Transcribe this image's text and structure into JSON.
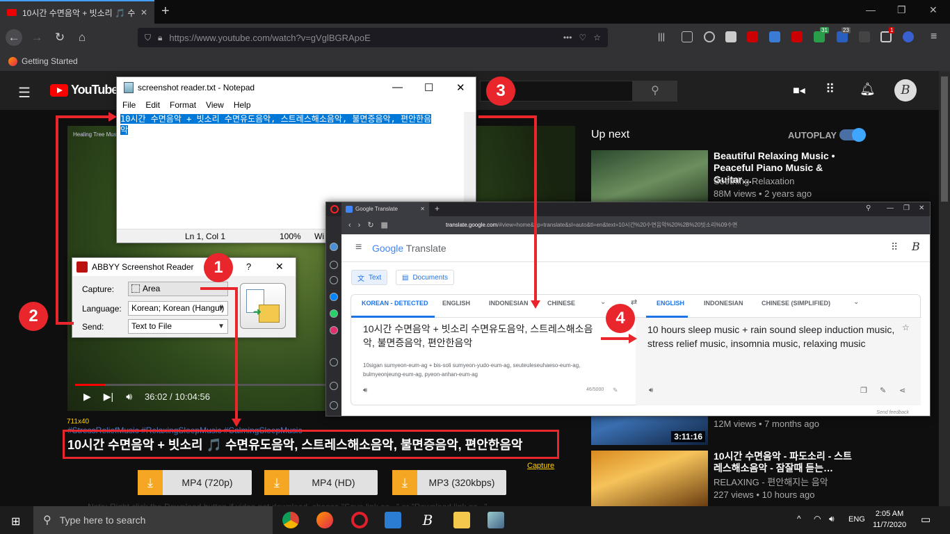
{
  "browser": {
    "tab_title": "10시간 수면음악 + 빗소리 🎵 수면",
    "url": "https://www.youtube.com/watch?v=gVglBGRApoE",
    "bookmark": "Getting Started",
    "badges": [
      "31",
      "23",
      "1"
    ]
  },
  "youtube": {
    "logo": "YouTube",
    "logo_region": "ID",
    "video_channel": "Healing Tree Music",
    "time": "36:02 / 10:04:56",
    "progress": 0.06,
    "dims": "711x40",
    "hashtags": "#StressReliefMusic #RelaxingSleepMusic #CalmingSleepMusic",
    "title": "10시간 수면음악 + 빗소리 🎵 수면유도음악, 스트레스해소음악, 불면증음악, 편안한음악",
    "capture": "Capture",
    "downloads": [
      "MP4 (720p)",
      "MP4 (HD)",
      "MP3 (320kbps)"
    ],
    "note": "Note: Right click the Download button if video not download, choose \"Save link as...\" or \"Download link as...\"",
    "up_next": "Up next",
    "autoplay": "AUTOPLAY",
    "related": [
      {
        "title": "Beautiful Relaxing Music • Peaceful Piano Music & Guitar…",
        "channel": "Soothing Relaxation",
        "meta": "88M views • 2 years ago"
      },
      {
        "title": "",
        "channel": "",
        "meta": "12M views • 7 months ago",
        "duration": "3:11:16"
      },
      {
        "title": "10시간 수면음악 - 파도소리 - 스트레스해소음악 - 잠잘때 듣는…",
        "channel": "RELAXING - 편안해지는 음악",
        "meta": "227 views • 10 hours ago"
      }
    ]
  },
  "notepad": {
    "title": "screenshot reader.txt - Notepad",
    "menu": [
      "File",
      "Edit",
      "Format",
      "View",
      "Help"
    ],
    "text_line1": "10시간 수면음악 + 빗소리      수면유도음악, 스트레스해소음악, 불면증음악, 편안한음",
    "text_line2": "악",
    "status_pos": "Ln 1, Col 1",
    "status_zoom": "100%",
    "status_enc": "Wi"
  },
  "abbyy": {
    "title": "ABBYY Screenshot Reader",
    "help": "?",
    "capture_label": "Capture:",
    "capture_value": "Area",
    "language_label": "Language:",
    "language_value": "Korean; Korean (Hangul)",
    "send_label": "Send:",
    "send_value": "Text to File"
  },
  "translate": {
    "tab_title": "Google Translate",
    "url_host": "translate.google.com",
    "url_rest": "/#view=home&op=translate&sl=auto&tl=en&text=10시간%20수면음악%20%2B%20빗소리%09수면",
    "logo_google": "Google",
    "logo_translate": "Translate",
    "mode_text": "Text",
    "mode_docs": "Documents",
    "src_langs": [
      "KOREAN - DETECTED",
      "ENGLISH",
      "INDONESIAN",
      "CHINESE"
    ],
    "dst_langs": [
      "ENGLISH",
      "INDONESIAN",
      "CHINESE (SIMPLIFIED)"
    ],
    "source_text": "10시간 수면음악 + 빗소리  수면유도음악, 스트레스해소음악, 불면증음악, 편안한음악",
    "romanization": "10sigan sumyeon-eum-ag + bis-soli sumyeon-yudo-eum-ag, seuteuleseuhaeso-eum-ag, bulmyeonjeung-eum-ag, pyeon-anhan-eum-ag",
    "char_count": "46/5000",
    "result": "10 hours sleep music + rain sound sleep induction music, stress relief music, insomnia music, relaxing music",
    "feedback": "Send feedback"
  },
  "annotations": [
    "1",
    "2",
    "3",
    "4"
  ],
  "taskbar": {
    "search_placeholder": "Type here to search",
    "lang": "ENG",
    "time": "2:05 AM",
    "date": "11/7/2020"
  }
}
